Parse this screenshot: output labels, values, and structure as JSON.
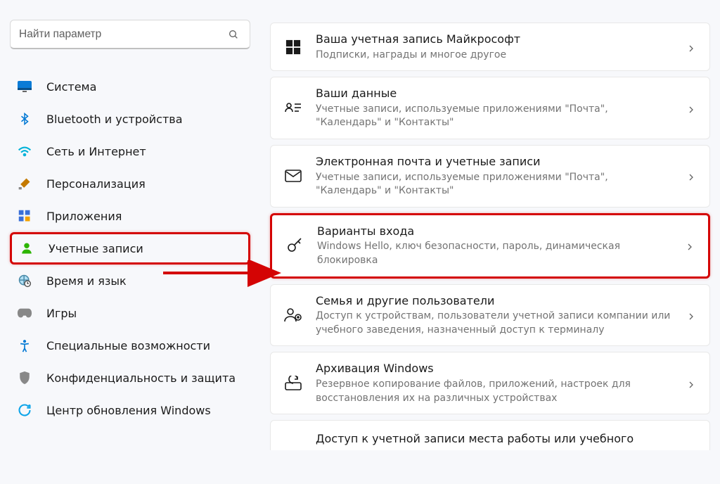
{
  "search": {
    "placeholder": "Найти параметр"
  },
  "sidebar": {
    "items": [
      {
        "label": "Система"
      },
      {
        "label": "Bluetooth и устройства"
      },
      {
        "label": "Сеть и Интернет"
      },
      {
        "label": "Персонализация"
      },
      {
        "label": "Приложения"
      },
      {
        "label": "Учетные записи"
      },
      {
        "label": "Время и язык"
      },
      {
        "label": "Игры"
      },
      {
        "label": "Специальные возможности"
      },
      {
        "label": "Конфиденциальность и защита"
      },
      {
        "label": "Центр обновления Windows"
      }
    ]
  },
  "cards": {
    "c0": {
      "title": "Ваша учетная запись Майкрософт",
      "sub": "Подписки, награды и многое другое"
    },
    "c1": {
      "title": "Ваши данные",
      "sub": "Учетные записи, используемые приложениями \"Почта\", \"Календарь\" и \"Контакты\""
    },
    "c2": {
      "title": "Электронная почта и учетные записи",
      "sub": "Учетные записи, используемые приложениями \"Почта\", \"Календарь\" и \"Контакты\""
    },
    "c3": {
      "title": "Варианты входа",
      "sub": "Windows Hello, ключ безопасности, пароль, динамическая блокировка"
    },
    "c4": {
      "title": "Семья и другие пользователи",
      "sub": "Доступ к устройствам, пользователи учетной записи компании или учебного заведения, назначенный доступ к терминалу"
    },
    "c5": {
      "title": "Архивация Windows",
      "sub": "Резервное копирование файлов, приложений, настроек для восстановления их на различных устройствах"
    },
    "c6": {
      "title": "Доступ к учетной записи места работы или учебного"
    }
  }
}
